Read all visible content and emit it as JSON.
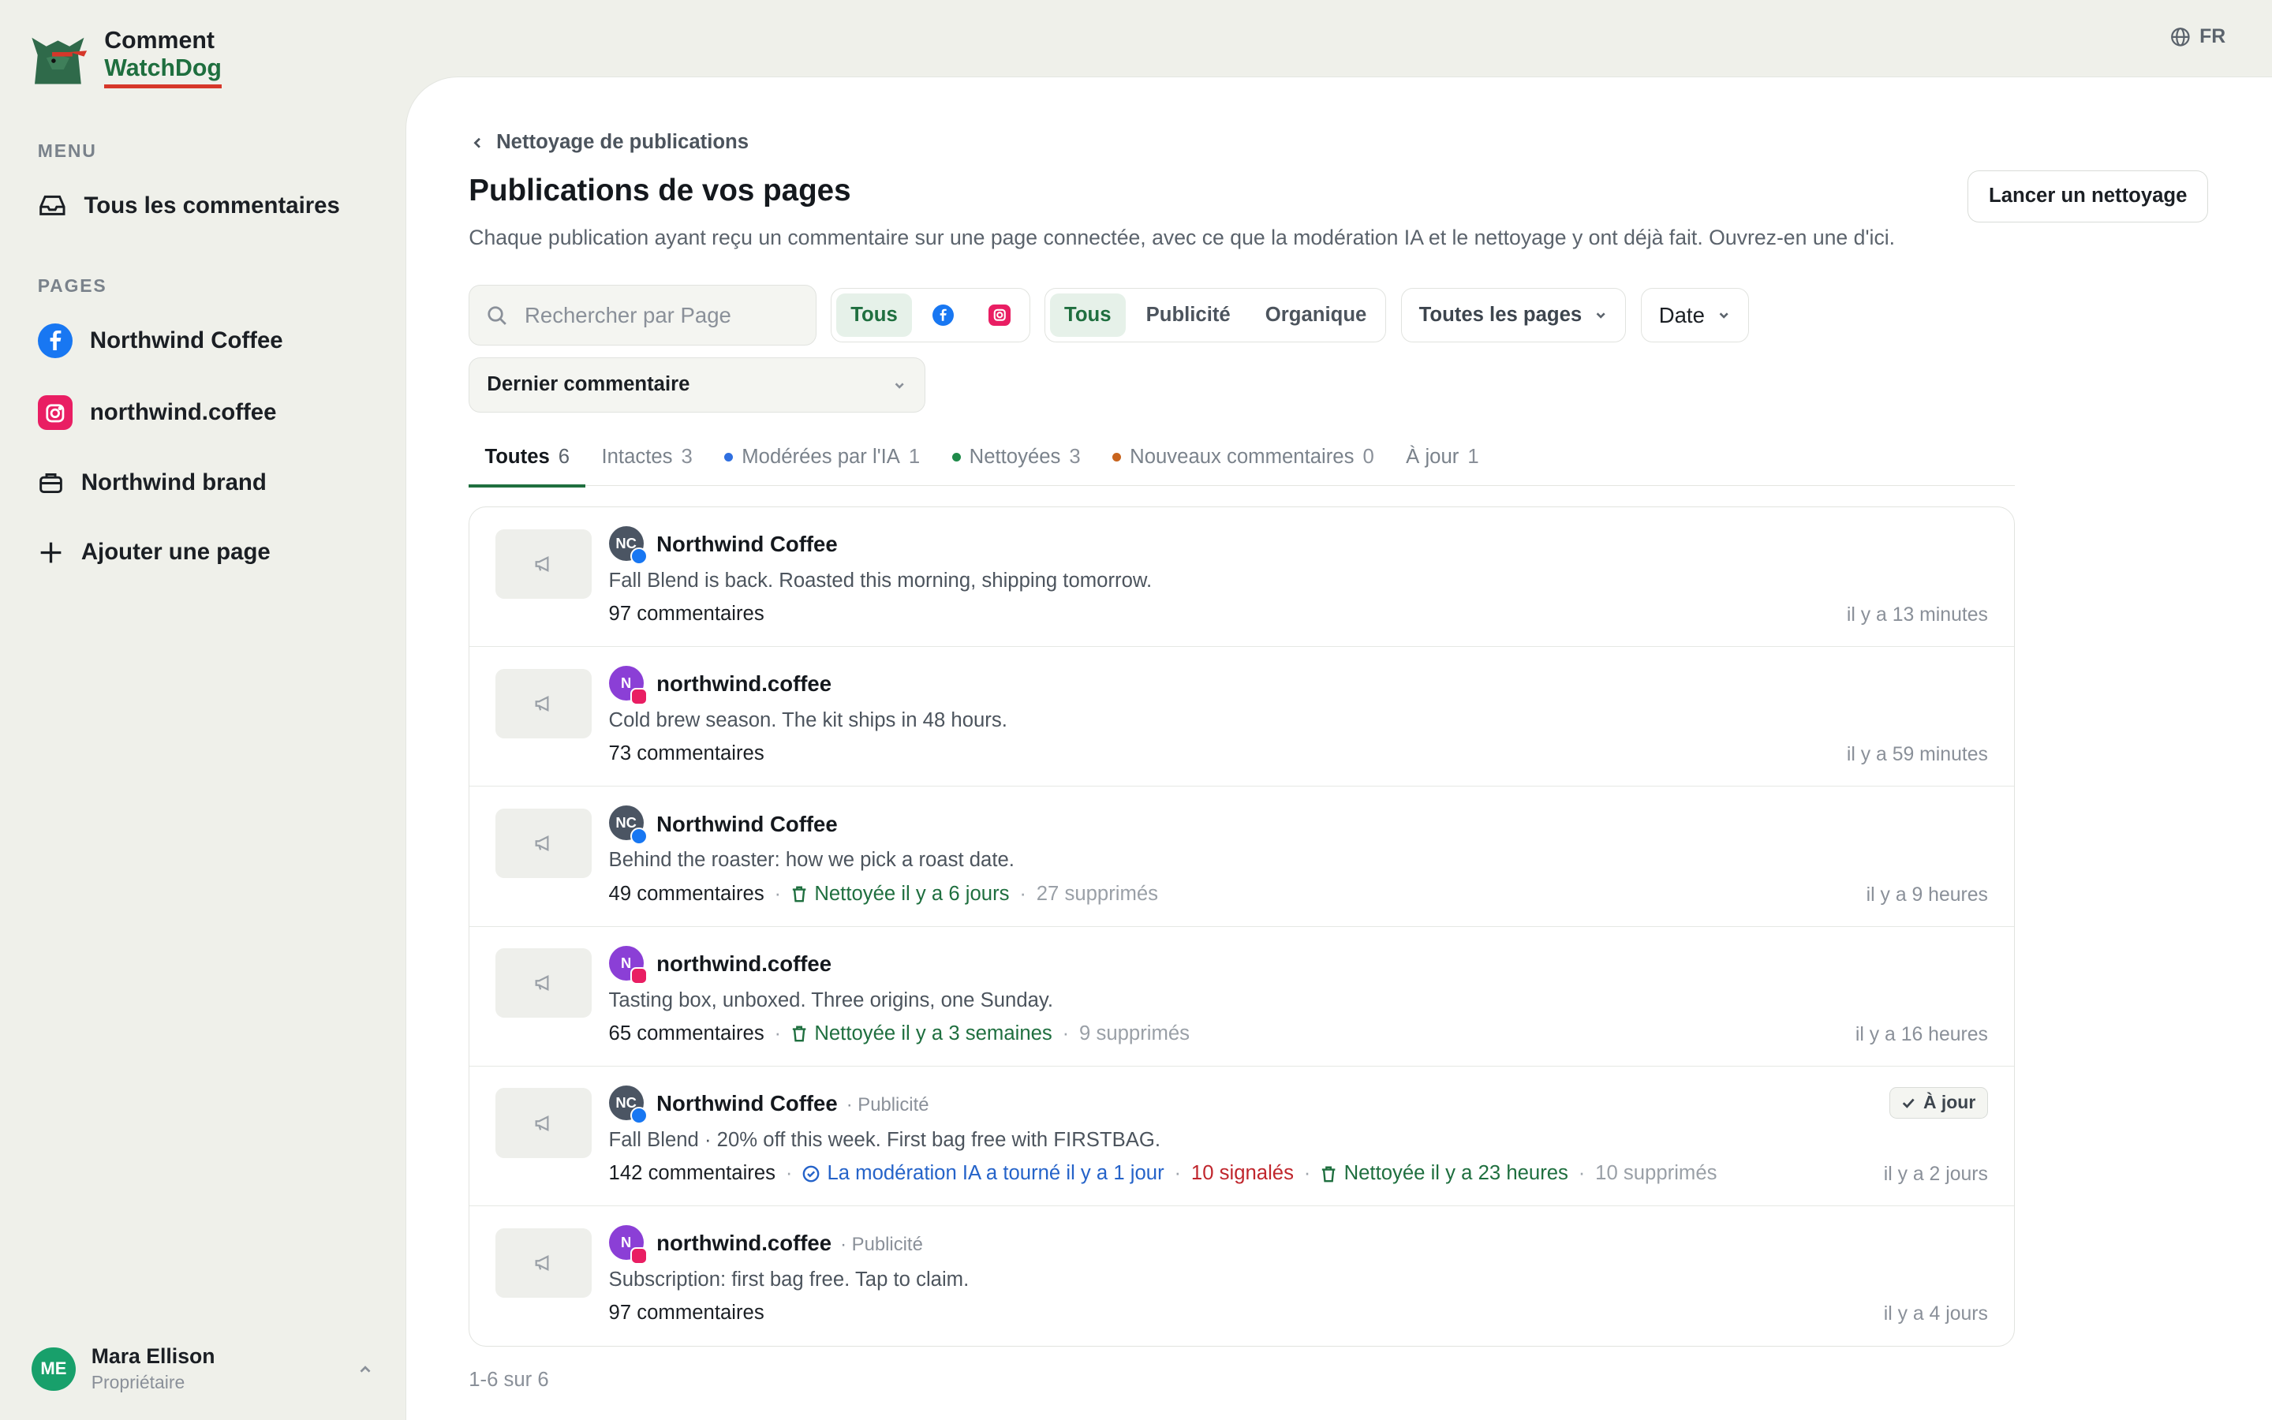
{
  "brand": {
    "line1": "Comment",
    "line2": "WatchDog"
  },
  "lang": "FR",
  "sidebar": {
    "menu_label": "MENU",
    "all_comments": "Tous les commentaires",
    "pages_label": "PAGES",
    "pages": [
      {
        "label": "Northwind Coffee",
        "icon": "facebook-icon"
      },
      {
        "label": "northwind.coffee",
        "icon": "instagram-icon"
      },
      {
        "label": "Northwind brand",
        "icon": "briefcase-icon"
      }
    ],
    "add_page": "Ajouter une page"
  },
  "user": {
    "initials": "ME",
    "name": "Mara Ellison",
    "role": "Propriétaire"
  },
  "header": {
    "breadcrumb": "Nettoyage de publications",
    "title": "Publications de vos pages",
    "subtitle": "Chaque publication ayant reçu un commentaire sur une page connectée, avec ce que la modération IA et le nettoyage y ont déjà fait. Ouvrez-en une d'ici.",
    "launch_button": "Lancer un nettoyage"
  },
  "filters": {
    "search_placeholder": "Rechercher par Page",
    "platform_all": "Tous",
    "type_options": [
      "Tous",
      "Publicité",
      "Organique"
    ],
    "pages_dropdown": "Toutes les pages",
    "date_dropdown": "Date",
    "sort": "Dernier commentaire"
  },
  "tabs": [
    {
      "label": "Toutes",
      "count": "6",
      "dot": ""
    },
    {
      "label": "Intactes",
      "count": "3",
      "dot": ""
    },
    {
      "label": "Modérées par l'IA",
      "count": "1",
      "dot": "#2f6fe0"
    },
    {
      "label": "Nettoyées",
      "count": "3",
      "dot": "#1f8a4a"
    },
    {
      "label": "Nouveaux commentaires",
      "count": "0",
      "dot": "#c8641e"
    },
    {
      "label": "À jour",
      "count": "1",
      "dot": ""
    }
  ],
  "posts": [
    {
      "page": "Northwind Coffee",
      "initials": "NC",
      "platform": "fb",
      "tag": "",
      "text": "Fall Blend is back. Roasted this morning, shipping tomorrow.",
      "comments": "97 commentaires",
      "ai": "",
      "flagged": "",
      "cleaned": "",
      "deleted": "",
      "status": "",
      "time": "il y a 13 minutes"
    },
    {
      "page": "northwind.coffee",
      "initials": "N",
      "platform": "ig",
      "tag": "",
      "text": "Cold brew season. The kit ships in 48 hours.",
      "comments": "73 commentaires",
      "ai": "",
      "flagged": "",
      "cleaned": "",
      "deleted": "",
      "status": "",
      "time": "il y a 59 minutes"
    },
    {
      "page": "Northwind Coffee",
      "initials": "NC",
      "platform": "fb",
      "tag": "",
      "text": "Behind the roaster: how we pick a roast date.",
      "comments": "49 commentaires",
      "ai": "",
      "flagged": "",
      "cleaned": "Nettoyée il y a 6 jours",
      "deleted": "27 supprimés",
      "status": "",
      "time": "il y a 9 heures"
    },
    {
      "page": "northwind.coffee",
      "initials": "N",
      "platform": "ig",
      "tag": "",
      "text": "Tasting box, unboxed. Three origins, one Sunday.",
      "comments": "65 commentaires",
      "ai": "",
      "flagged": "",
      "cleaned": "Nettoyée il y a 3 semaines",
      "deleted": "9 supprimés",
      "status": "",
      "time": "il y a 16 heures"
    },
    {
      "page": "Northwind Coffee",
      "initials": "NC",
      "platform": "fb",
      "tag": "· Publicité",
      "text": "Fall Blend · 20% off this week. First bag free with FIRSTBAG.",
      "comments": "142 commentaires",
      "ai": "La modération IA a tourné il y a 1 jour",
      "flagged": "10 signalés",
      "cleaned": "Nettoyée il y a 23 heures",
      "deleted": "10 supprimés",
      "status": "À jour",
      "time": "il y a 2 jours"
    },
    {
      "page": "northwind.coffee",
      "initials": "N",
      "platform": "ig",
      "tag": "· Publicité",
      "text": "Subscription: first bag free. Tap to claim.",
      "comments": "97 commentaires",
      "ai": "",
      "flagged": "",
      "cleaned": "",
      "deleted": "",
      "status": "",
      "time": "il y a 4 jours"
    }
  ],
  "pager": "1-6 sur 6"
}
